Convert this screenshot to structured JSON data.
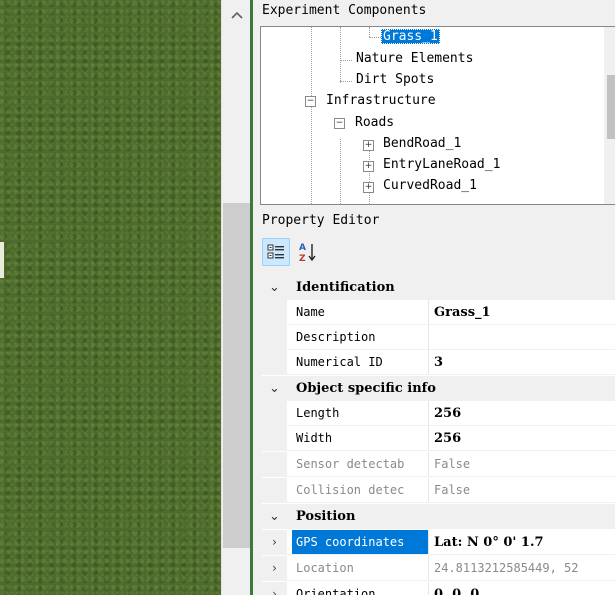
{
  "viewport": {
    "alt": "grass terrain view"
  },
  "scrollbar": {
    "up_arrow": "^"
  },
  "components": {
    "title": "Experiment Components",
    "tree": [
      {
        "label": "Grass_1",
        "selected": true
      },
      {
        "label": "Nature Elements"
      },
      {
        "label": "Dirt Spots"
      },
      {
        "label": "Infrastructure",
        "expander": "−"
      },
      {
        "label": "Roads",
        "expander": "−"
      },
      {
        "label": "BendRoad_1",
        "expander": "+"
      },
      {
        "label": "EntryLaneRoad_1",
        "expander": "+"
      },
      {
        "label": "CurvedRoad_1",
        "expander": "+"
      }
    ]
  },
  "property_editor": {
    "title": "Property Editor",
    "toolbar": [
      {
        "name": "categorized-view-icon",
        "active": true
      },
      {
        "name": "alphabetical-sort-icon",
        "active": false
      }
    ],
    "categories": {
      "identification": "Identification",
      "object_specific": "Object specific info",
      "position": "Position"
    },
    "rows": {
      "name": {
        "label": "Name",
        "value": "Grass_1"
      },
      "description": {
        "label": "Description",
        "value": ""
      },
      "numerical_id": {
        "label": "Numerical ID",
        "value": "3"
      },
      "length": {
        "label": "Length",
        "value": "256"
      },
      "width": {
        "label": "Width",
        "value": "256"
      },
      "sensor": {
        "label": "Sensor detectab",
        "value": "False"
      },
      "collision": {
        "label": "Collision detec",
        "value": "False"
      },
      "gps": {
        "label": "GPS coordinates",
        "value": "Lat: N 0° 0' 1.7"
      },
      "location": {
        "label": "Location",
        "value": "24.8113212585449, 52"
      },
      "orientation": {
        "label": "Orientation",
        "value": "0, 0, 0"
      }
    }
  }
}
